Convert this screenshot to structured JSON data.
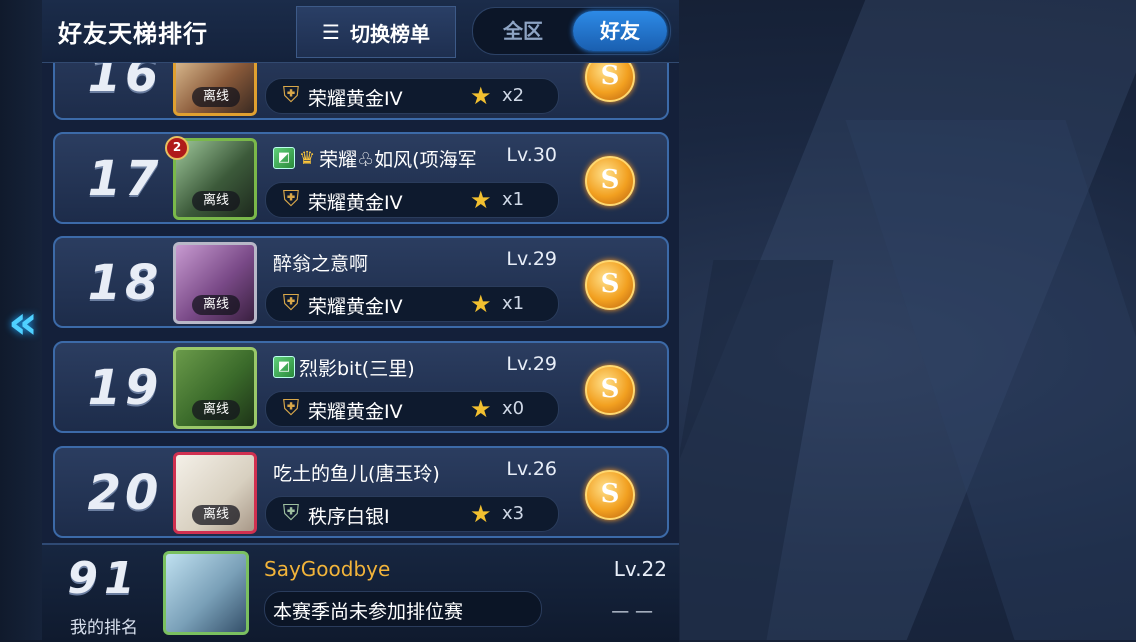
{
  "header": {
    "title": "好友天梯排行",
    "switch_label": "切换榜单",
    "switch_icon": "list-icon",
    "tabs": [
      {
        "label": "全区",
        "active": false
      },
      {
        "label": "好友",
        "active": true
      }
    ]
  },
  "rows": [
    {
      "rank": "16",
      "name": "",
      "level": "",
      "tier": "荣耀黄金IV",
      "stars": "x2",
      "status": "离线",
      "badge": ""
    },
    {
      "rank": "17",
      "name": "荣耀♧如风(项海军",
      "level": "Lv.30",
      "tier": "荣耀黄金IV",
      "stars": "x1",
      "status": "离线",
      "badge": "2"
    },
    {
      "rank": "18",
      "name": "醉翁之意啊",
      "level": "Lv.29",
      "tier": "荣耀黄金IV",
      "stars": "x1",
      "status": "离线",
      "badge": ""
    },
    {
      "rank": "19",
      "name": "烈影bit(三里)",
      "level": "Lv.29",
      "tier": "荣耀黄金IV",
      "stars": "x0",
      "status": "离线",
      "badge": ""
    },
    {
      "rank": "20",
      "name": "吃土的鱼儿(唐玉玲)",
      "level": "Lv.26",
      "tier": "秩序白银I",
      "stars": "x3",
      "status": "离线",
      "badge": ""
    }
  ],
  "my_rank": {
    "rank": "91",
    "label": "我的排名",
    "name": "SayGoodbye",
    "level": "Lv.22",
    "status": "本赛季尚未参加排位赛",
    "stars": "— —"
  },
  "colors": {
    "accent_blue": "#2d8ae6",
    "gold_name": "#f2b43a",
    "row_border": "#3c6aa8",
    "star": "#f2c030"
  }
}
